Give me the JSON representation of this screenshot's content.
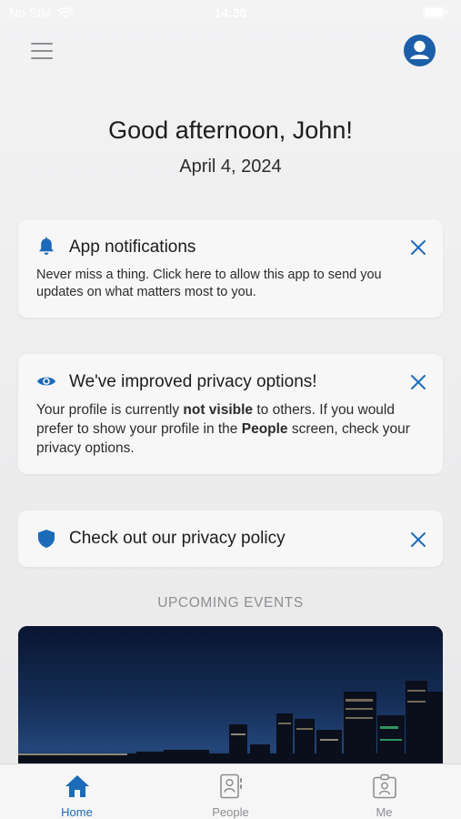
{
  "status_bar": {
    "carrier": "No SIM",
    "time": "14:38"
  },
  "header": {
    "greeting": "Good afternoon, John!",
    "date": "April 4, 2024"
  },
  "cards": [
    {
      "icon": "bell-icon",
      "title": "App notifications",
      "body": "Never miss a thing. Click here to allow this app to send you updates on what matters most to you."
    },
    {
      "icon": "eye-icon",
      "title": "We've improved privacy options!",
      "body_parts": [
        "Your profile is currently ",
        "not visible",
        " to others. If you would prefer to show your profile in the ",
        "People",
        " screen, check your privacy options."
      ]
    },
    {
      "icon": "shield-icon",
      "title": "Check out our privacy policy"
    }
  ],
  "events": {
    "section_label": "UPCOMING EVENTS"
  },
  "tab_bar": {
    "items": [
      {
        "label": "Home",
        "icon": "home-icon",
        "active": true
      },
      {
        "label": "People",
        "icon": "people-icon",
        "active": false
      },
      {
        "label": "Me",
        "icon": "me-icon",
        "active": false
      }
    ]
  },
  "colors": {
    "accent": "#1c6bb9",
    "avatar": "#1c5fa8",
    "muted": "#8e8e93"
  }
}
